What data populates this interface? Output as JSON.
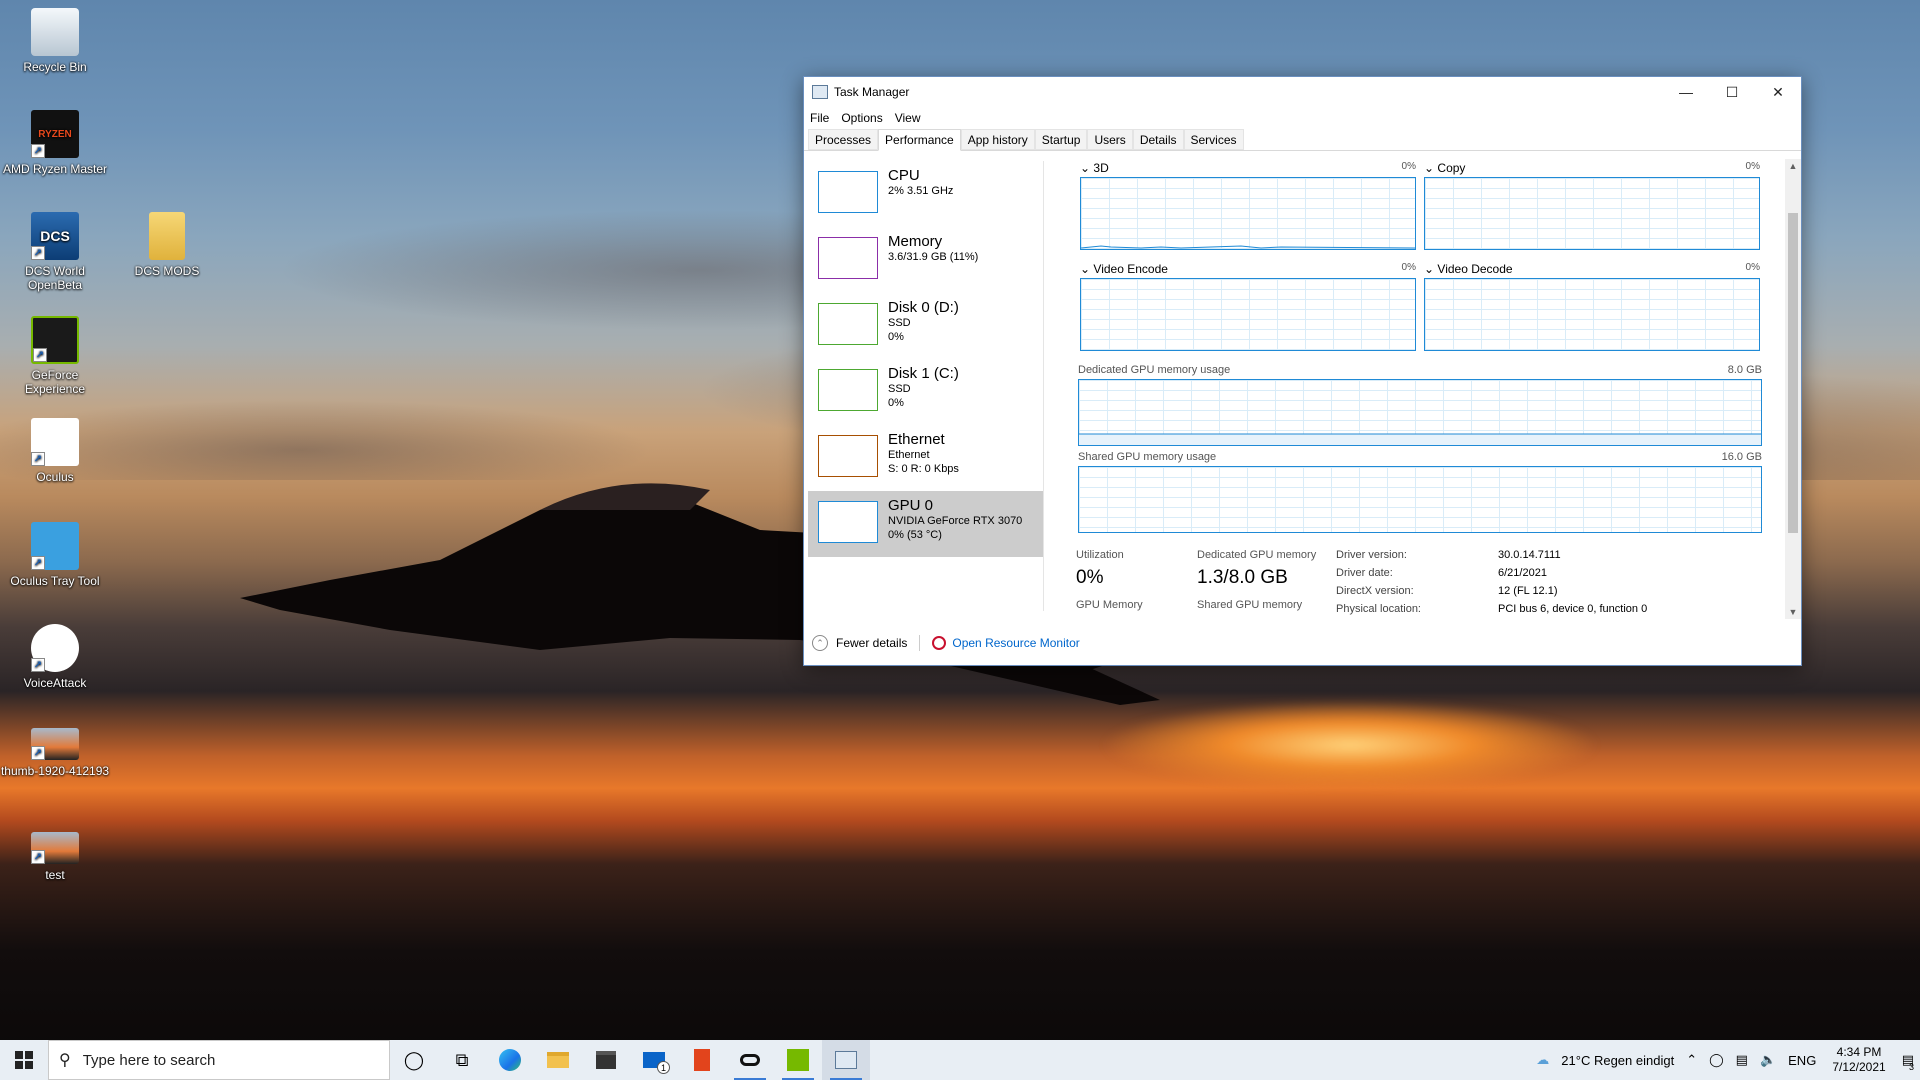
{
  "desktop": {
    "icons": [
      {
        "label": "Recycle Bin",
        "icon": "recycle-bin-icon"
      },
      {
        "label": "AMD Ryzen Master",
        "icon": "ryzen-icon",
        "badge": "RYZEN"
      },
      {
        "label": "DCS World OpenBeta",
        "icon": "dcs-icon",
        "badge": "DCS"
      },
      {
        "label": "DCS MODS",
        "icon": "folder-icon"
      },
      {
        "label": "GeForce Experience",
        "icon": "nvidia-icon"
      },
      {
        "label": "Oculus",
        "icon": "oculus-icon"
      },
      {
        "label": "Oculus Tray Tool",
        "icon": "oculus-tray-icon"
      },
      {
        "label": "VoiceAttack",
        "icon": "voiceattack-icon"
      },
      {
        "label": "thumb-1920-412193",
        "icon": "image-thumb-icon"
      },
      {
        "label": "test",
        "icon": "image-thumb-icon"
      }
    ]
  },
  "window": {
    "title": "Task Manager",
    "menu": [
      "File",
      "Options",
      "View"
    ],
    "tabs": [
      "Processes",
      "Performance",
      "App history",
      "Startup",
      "Users",
      "Details",
      "Services"
    ],
    "selected_tab": "Performance",
    "resources": [
      {
        "name": "CPU",
        "sub1": "2% 3.51 GHz",
        "sub2": "",
        "sub3": "",
        "color": "#1f8ad6"
      },
      {
        "name": "Memory",
        "sub1": "3.6/31.9 GB (11%)",
        "sub2": "",
        "sub3": "",
        "color": "#8b2ea8"
      },
      {
        "name": "Disk 0 (D:)",
        "sub1": "SSD",
        "sub2": "0%",
        "sub3": "",
        "color": "#4da831"
      },
      {
        "name": "Disk 1 (C:)",
        "sub1": "SSD",
        "sub2": "0%",
        "sub3": "",
        "color": "#4da831"
      },
      {
        "name": "Ethernet",
        "sub1": "Ethernet",
        "sub2": "S: 0 R: 0 Kbps",
        "sub3": "",
        "color": "#a74f01"
      },
      {
        "name": "GPU 0",
        "sub1": "NVIDIA GeForce RTX 3070",
        "sub2": "0% (53 °C)",
        "sub3": "",
        "color": "#1f8ad6"
      }
    ],
    "gpu": {
      "engines": [
        {
          "name": "3D",
          "pct": "0%"
        },
        {
          "name": "Copy",
          "pct": "0%"
        },
        {
          "name": "Video Encode",
          "pct": "0%"
        },
        {
          "name": "Video Decode",
          "pct": "0%"
        }
      ],
      "dedicated_label": "Dedicated GPU memory usage",
      "dedicated_max": "8.0 GB",
      "shared_label": "Shared GPU memory usage",
      "shared_max": "16.0 GB",
      "stats": {
        "utilization_label": "Utilization",
        "utilization_value": "0%",
        "dedicated_mem_label": "Dedicated GPU memory",
        "dedicated_mem_value": "1.3/8.0 GB",
        "gpu_memory_label": "GPU Memory",
        "shared_mem_label": "Shared GPU memory"
      },
      "info": {
        "driver_version_label": "Driver version:",
        "driver_version": "30.0.14.7111",
        "driver_date_label": "Driver date:",
        "driver_date": "6/21/2021",
        "directx_label": "DirectX version:",
        "directx": "12 (FL 12.1)",
        "physical_label": "Physical location:",
        "physical": "PCI bus 6, device 0, function 0"
      }
    },
    "footer": {
      "fewer_details": "Fewer details",
      "resource_monitor": "Open Resource Monitor"
    }
  },
  "taskbar": {
    "search_placeholder": "Type here to search",
    "weather": "21°C  Regen eindigt",
    "language": "ENG",
    "time": "4:34 PM",
    "date": "7/12/2021",
    "notifications": "3",
    "mail_badge": "1"
  }
}
